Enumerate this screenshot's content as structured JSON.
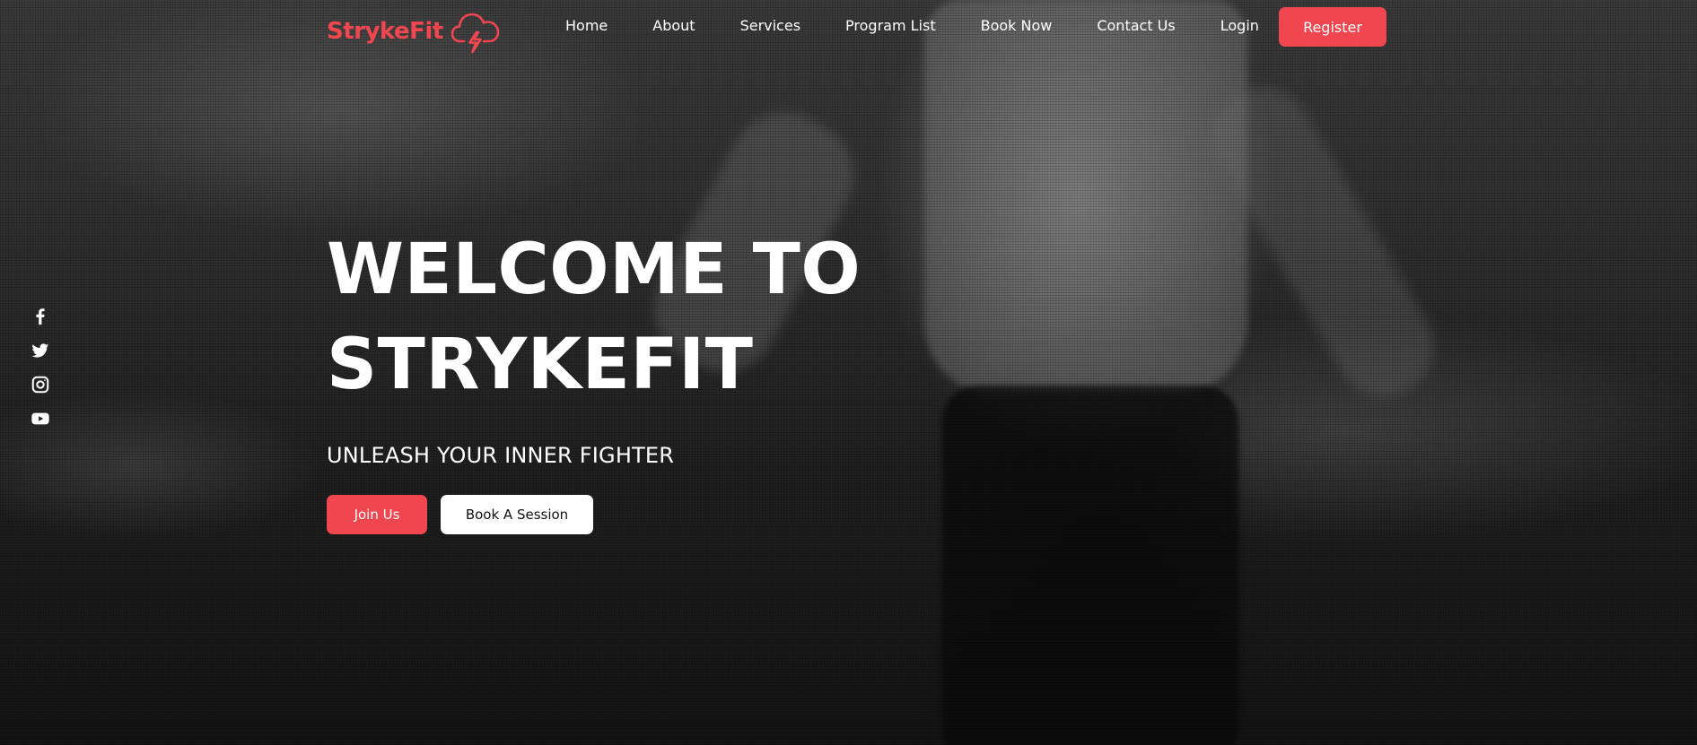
{
  "brand": {
    "name": "StrykeFit",
    "accent_color": "#ef4650",
    "logo_icon": "cloud-lightning-icon"
  },
  "nav": {
    "links": [
      "Home",
      "About",
      "Services",
      "Program List",
      "Book Now",
      "Contact Us",
      "Login"
    ],
    "register_label": "Register"
  },
  "social": [
    "facebook-icon",
    "twitter-icon",
    "instagram-icon",
    "youtube-icon"
  ],
  "hero": {
    "title_line1": "WELCOME TO",
    "title_line2": "STRYKEFIT",
    "subtitle": "UNLEASH YOUR INNER FIGHTER",
    "join_label": "Join Us",
    "book_label": "Book A Session"
  }
}
